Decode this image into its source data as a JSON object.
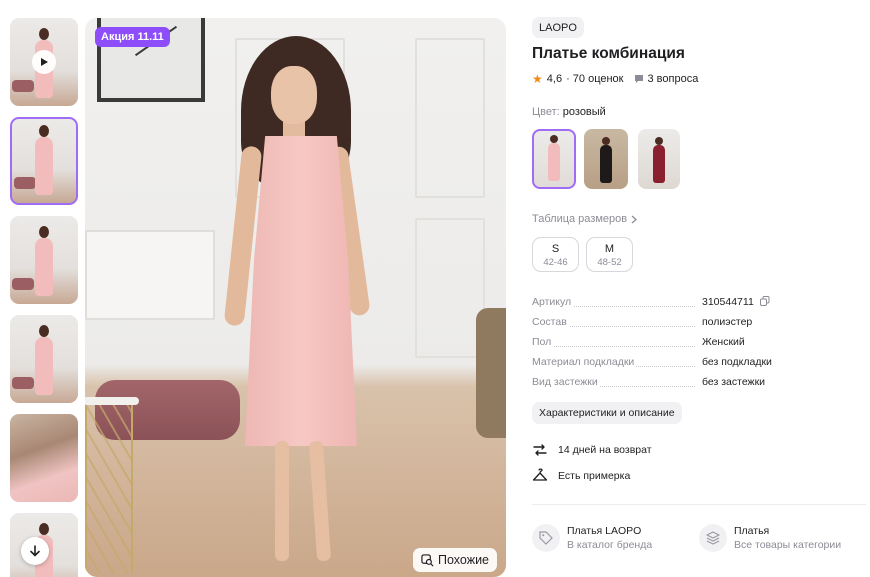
{
  "gallery": {
    "promo_badge": "Акция 11.11",
    "similar_label": "Похожие",
    "thumbnails": [
      {
        "kind": "video",
        "selected": false
      },
      {
        "kind": "photo",
        "selected": true
      },
      {
        "kind": "photo",
        "selected": false
      },
      {
        "kind": "photo",
        "selected": false
      },
      {
        "kind": "closeup",
        "selected": false
      },
      {
        "kind": "photo",
        "selected": false
      }
    ]
  },
  "product": {
    "brand": "LAOPO",
    "title": "Платье комбинация",
    "rating": "4,6",
    "reviews": "· 70 оценок",
    "questions": "3 вопроса",
    "color_label": "Цвет:",
    "color_value": "розовый",
    "color_swatches": [
      {
        "name": "pink",
        "color": "#f2bcbc",
        "selected": true
      },
      {
        "name": "black",
        "color": "#1e1a1a",
        "selected": false
      },
      {
        "name": "burgundy",
        "color": "#8a1f2d",
        "selected": false
      }
    ],
    "size_table_link": "Таблица размеров",
    "sizes": [
      {
        "label": "S",
        "range": "42-46"
      },
      {
        "label": "M",
        "range": "48-52"
      }
    ],
    "specs": [
      {
        "key": "Артикул",
        "value": "310544711"
      },
      {
        "key": "Состав",
        "value": "полиэстер"
      },
      {
        "key": "Пол",
        "value": "Женский"
      },
      {
        "key": "Материал подкладки",
        "value": "без подкладки"
      },
      {
        "key": "Вид застежки",
        "value": "без застежки"
      }
    ],
    "details_button": "Характеристики и описание",
    "perks": [
      {
        "icon": "return-arrows-icon",
        "text": "14 дней на возврат"
      },
      {
        "icon": "hanger-icon",
        "text": "Есть примерка"
      }
    ],
    "category_links": [
      {
        "icon": "tag-icon",
        "title": "Платья LAOPO",
        "subtitle": "В каталог бренда"
      },
      {
        "icon": "layers-icon",
        "title": "Платья",
        "subtitle": "Все товары категории"
      }
    ]
  },
  "colors": {
    "accent_purple": "#8d4dfb",
    "selected_border": "#a06cf5",
    "star": "#f28b1c",
    "muted_text": "#8c8c96"
  }
}
